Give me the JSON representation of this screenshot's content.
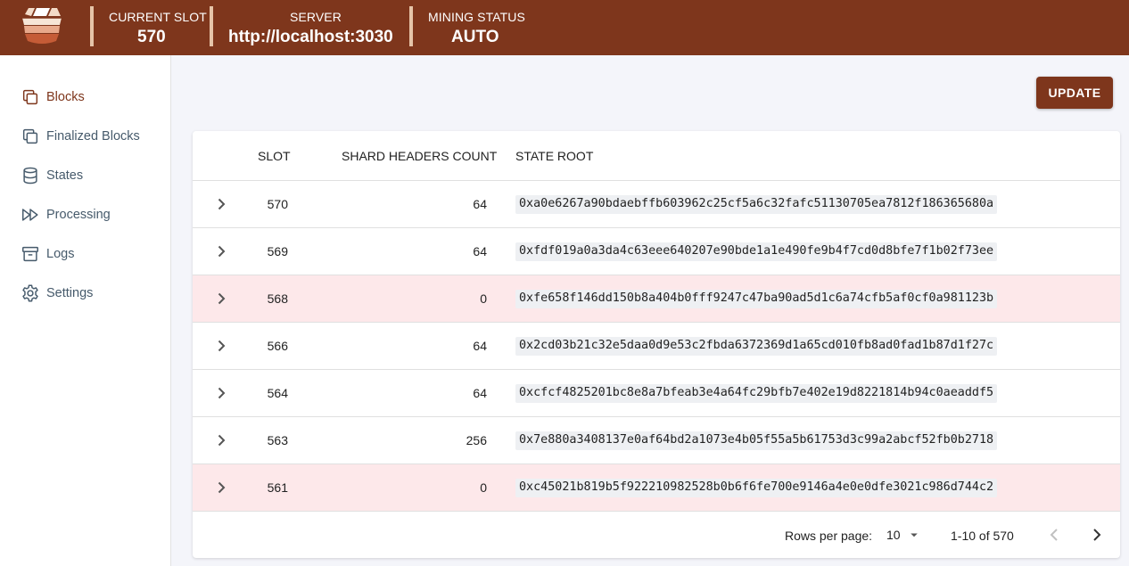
{
  "header": {
    "logo": "wood-barrel-logo",
    "stats": [
      {
        "label": "CURRENT SLOT",
        "value": "570"
      },
      {
        "label": "SERVER",
        "value": "http://localhost:3030"
      },
      {
        "label": "MINING STATUS",
        "value": "AUTO"
      }
    ]
  },
  "sidebar": {
    "items": [
      {
        "label": "Blocks",
        "icon": "copy-icon",
        "active": true
      },
      {
        "label": "Finalized Blocks",
        "icon": "copy-icon",
        "active": false
      },
      {
        "label": "States",
        "icon": "database-icon",
        "active": false
      },
      {
        "label": "Processing",
        "icon": "fast-forward-icon",
        "active": false
      },
      {
        "label": "Logs",
        "icon": "archive-icon",
        "active": false
      },
      {
        "label": "Settings",
        "icon": "gear-icon",
        "active": false
      }
    ]
  },
  "toolbar": {
    "update_label": "UPDATE"
  },
  "table": {
    "columns": [
      "SLOT",
      "SHARD HEADERS COUNT",
      "STATE ROOT"
    ],
    "rows": [
      {
        "slot": "570",
        "count": "64",
        "root": "0xa0e6267a90bdaebffb603962c25cf5a6c32fafc51130705ea7812f186365680a",
        "failed": false
      },
      {
        "slot": "569",
        "count": "64",
        "root": "0xfdf019a0a3da4c63eee640207e90bde1a1e490fe9b4f7cd0d8bfe7f1b02f73ee",
        "failed": false
      },
      {
        "slot": "568",
        "count": "0",
        "root": "0xfe658f146dd150b8a404b0fff9247c47ba90ad5d1c6a74cfb5af0cf0a981123b",
        "failed": true
      },
      {
        "slot": "566",
        "count": "64",
        "root": "0x2cd03b21c32e5daa0d9e53c2fbda6372369d1a65cd010fb8ad0fad1b87d1f27c",
        "failed": false
      },
      {
        "slot": "564",
        "count": "64",
        "root": "0xcfcf4825201bc8e8a7bfeab3e4a64fc29bfb7e402e19d8221814b94c0aeaddf5",
        "failed": false
      },
      {
        "slot": "563",
        "count": "256",
        "root": "0x7e880a3408137e0af64bd2a1073e4b05f55a5b61753d3c99a2abcf52fb0b2718",
        "failed": false
      },
      {
        "slot": "561",
        "count": "0",
        "root": "0xc45021b819b5f922210982528b0b6f6fe700e9146a4e0e0dfe3021c986d744c2",
        "failed": true
      }
    ]
  },
  "pagination": {
    "rows_per_page_label": "Rows per page:",
    "rows_per_page": "10",
    "range": "1-10 of 570"
  },
  "colors": {
    "brand": "#7e361c",
    "failed_row": "#fde8ea",
    "nav_text": "#465a6b"
  }
}
